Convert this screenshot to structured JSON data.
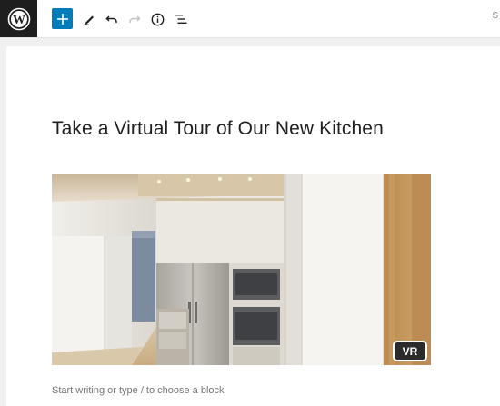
{
  "toolbar": {
    "edge_label": "S"
  },
  "post": {
    "title": "Take a Virtual Tour of Our New Kitchen",
    "image_badge": "VR",
    "placeholder": "Start writing or type / to choose a block"
  },
  "colors": {
    "toolbar_bg": "#ffffff",
    "logo_bg": "#1e1e1e",
    "accent": "#007cba",
    "canvas_bg": "#ffffff",
    "page_bg": "#f0f0f0"
  },
  "icons": {
    "logo": "wordpress-logo-icon",
    "add": "plus-icon",
    "tools": "pencil-icon",
    "undo": "undo-icon",
    "redo": "redo-icon",
    "details": "info-icon",
    "outline": "list-view-icon"
  }
}
